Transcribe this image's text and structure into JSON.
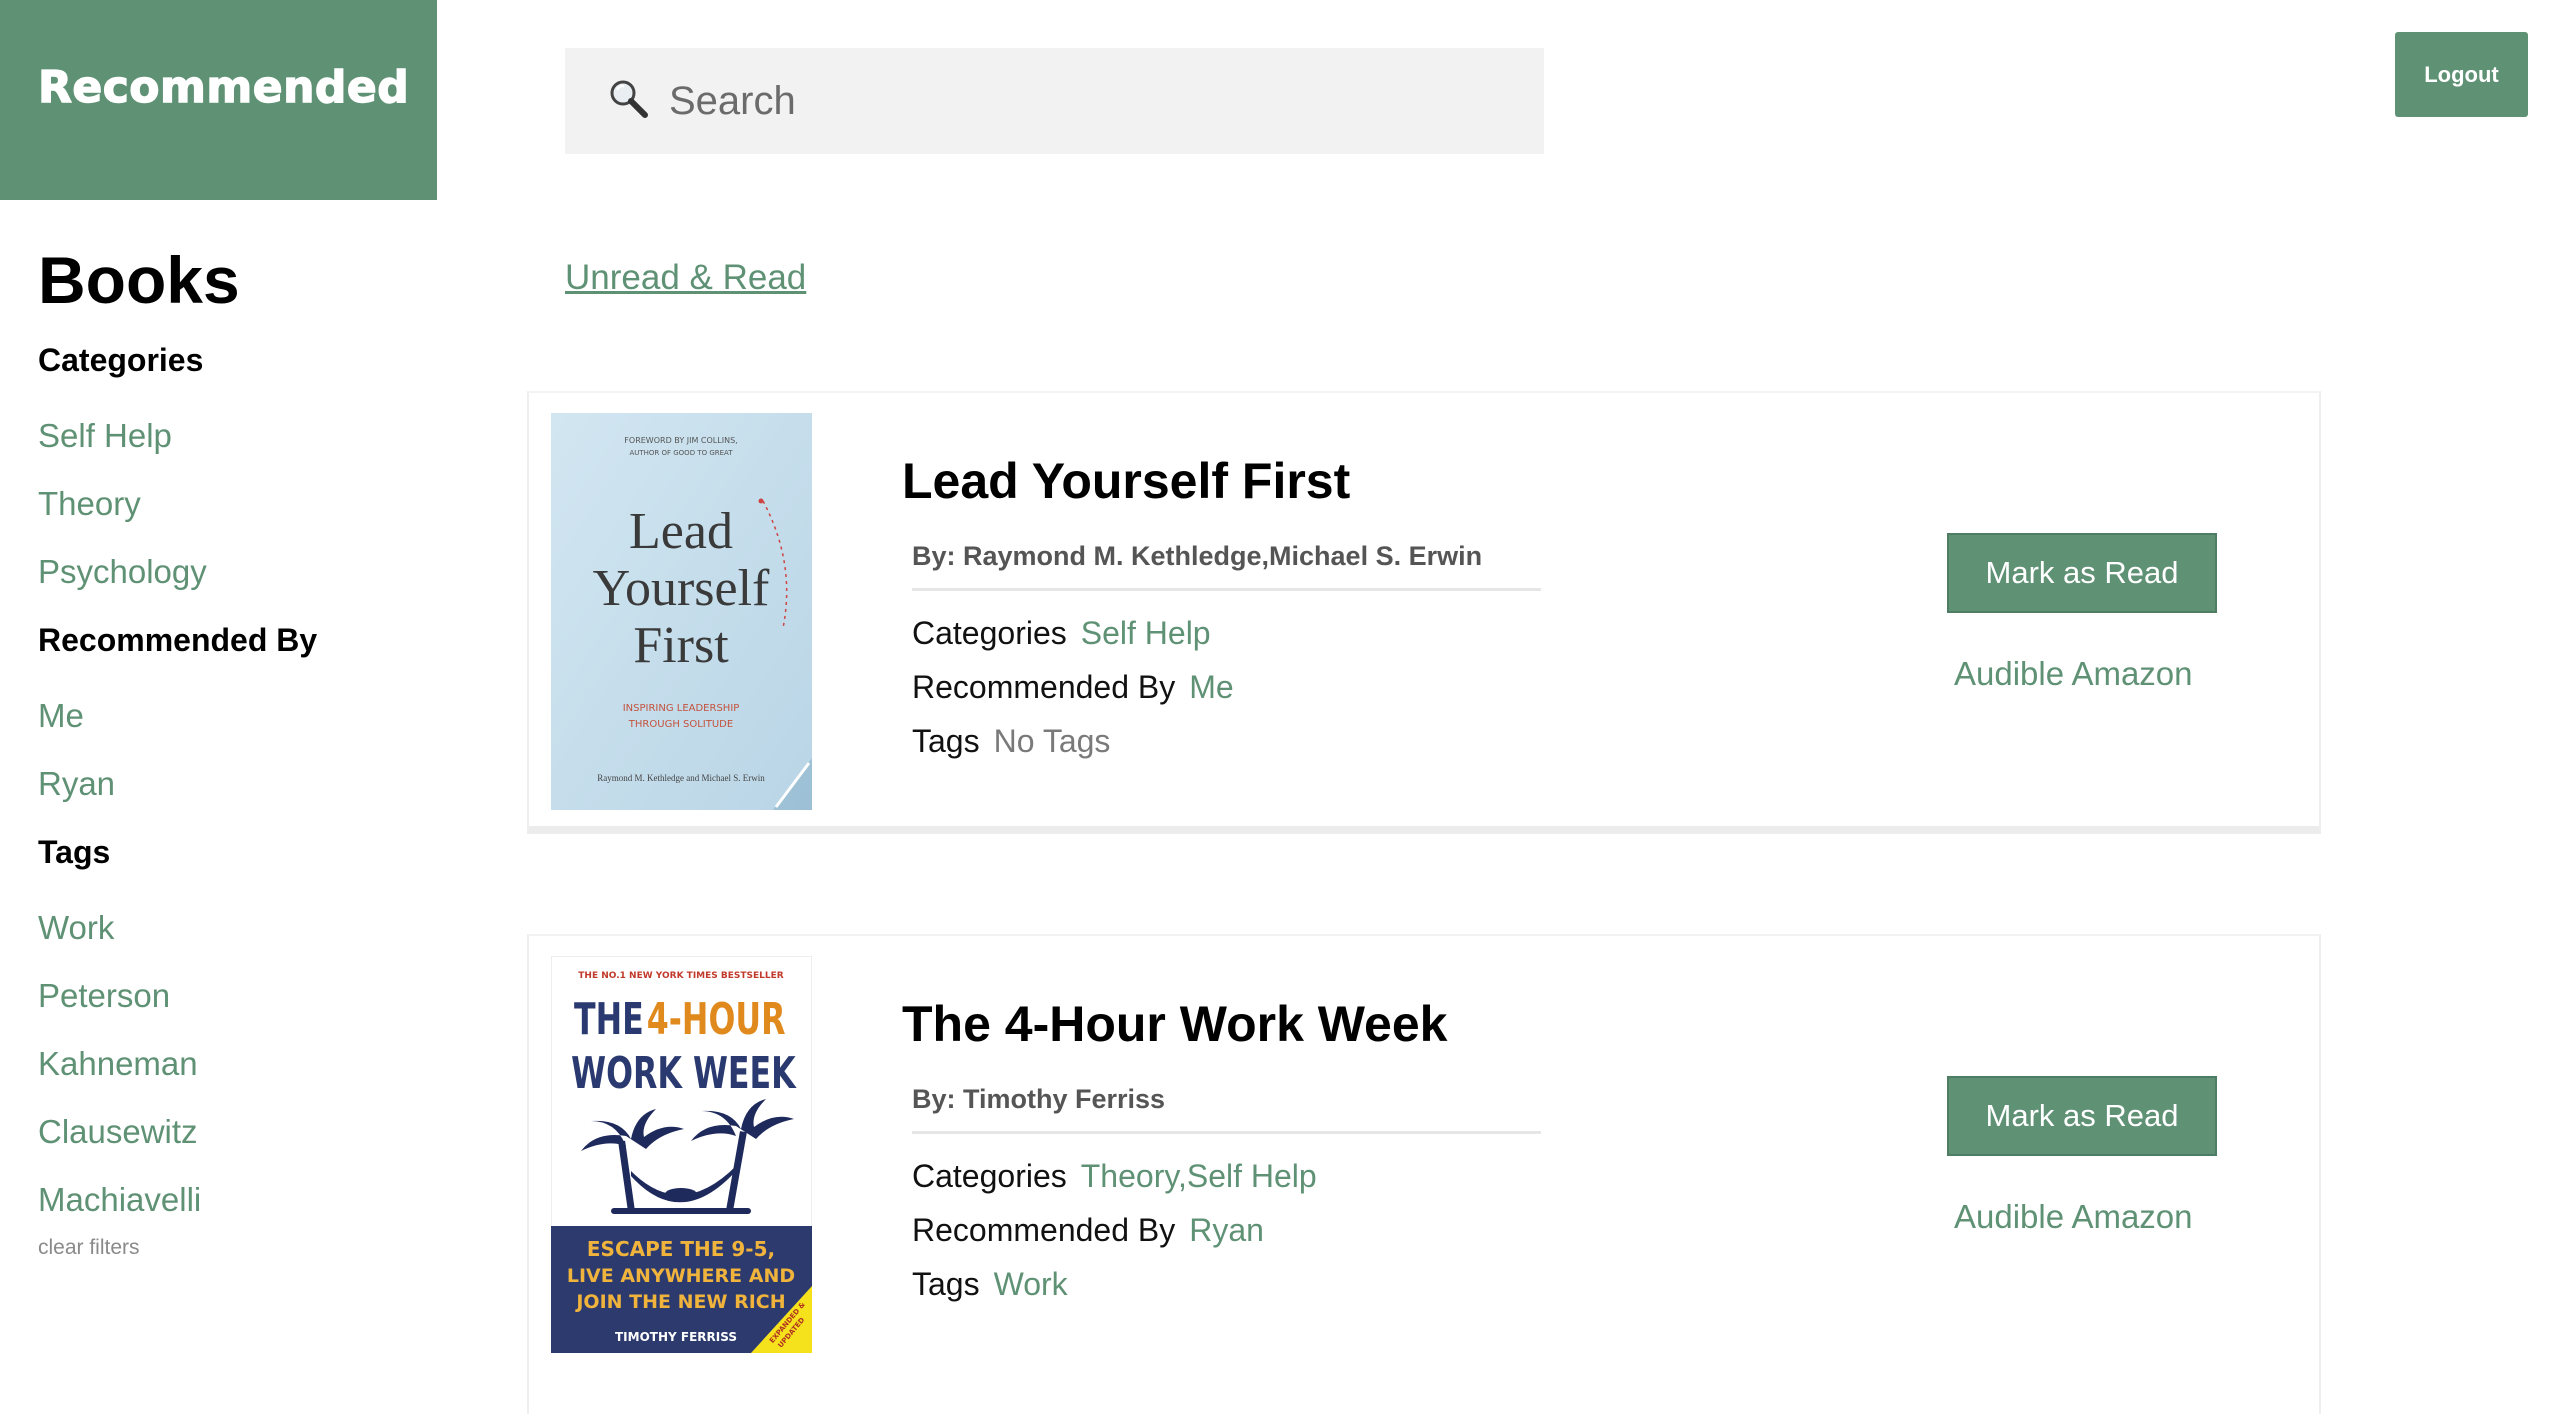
{
  "theme": {
    "accent": "#5f9175"
  },
  "header": {
    "brand": "Recommended",
    "search_placeholder": "Search",
    "logout_label": "Logout"
  },
  "sidebar": {
    "title": "Books",
    "categories_title": "Categories",
    "categories": [
      "Self Help",
      "Theory",
      "Psychology"
    ],
    "recommended_title": "Recommended By",
    "recommended": [
      "Me",
      "Ryan"
    ],
    "tags_title": "Tags",
    "tags": [
      "Work",
      "Peterson",
      "Kahneman",
      "Clausewitz",
      "Machiavelli"
    ],
    "clear_filters": "clear filters"
  },
  "filter_link": "Unread & Read",
  "labels": {
    "categories": "Categories",
    "recommended_by": "Recommended By",
    "tags": "Tags",
    "mark_as_read": "Mark as Read",
    "audible": "Audible",
    "amazon": "Amazon"
  },
  "books": [
    {
      "title": "Lead Yourself First",
      "by": "By: Raymond M. Kethledge,Michael S. Erwin",
      "categories": "Self Help",
      "recommended_by": "Me",
      "tags": "No Tags",
      "cover": {
        "top_text_1": "FOREWORD BY JIM COLLINS,",
        "top_text_2": "AUTHOR OF GOOD TO GREAT",
        "title_1": "Lead",
        "title_2": "Yourself",
        "title_3": "First",
        "subtitle_1": "INSPIRING LEADERSHIP",
        "subtitle_2": "THROUGH SOLITUDE",
        "authors": "Raymond M. Kethledge and Michael S. Erwin"
      }
    },
    {
      "title": "The 4-Hour Work Week",
      "by": "By: Timothy Ferriss",
      "categories": "Theory,Self Help",
      "recommended_by": "Ryan",
      "tags": "Work",
      "cover": {
        "top_text": "THE NO.1 NEW YORK TIMES BESTSELLER",
        "title_the": "THE",
        "title_4hour": "4-HOUR",
        "title_workweek": "WORK WEEK",
        "tagline_1": "ESCAPE THE 9-5,",
        "tagline_2": "LIVE ANYWHERE AND",
        "tagline_3": "JOIN THE NEW RICH",
        "author": "TIMOTHY FERRISS",
        "corner_1": "EXPANDED &",
        "corner_2": "UPDATED"
      }
    }
  ]
}
